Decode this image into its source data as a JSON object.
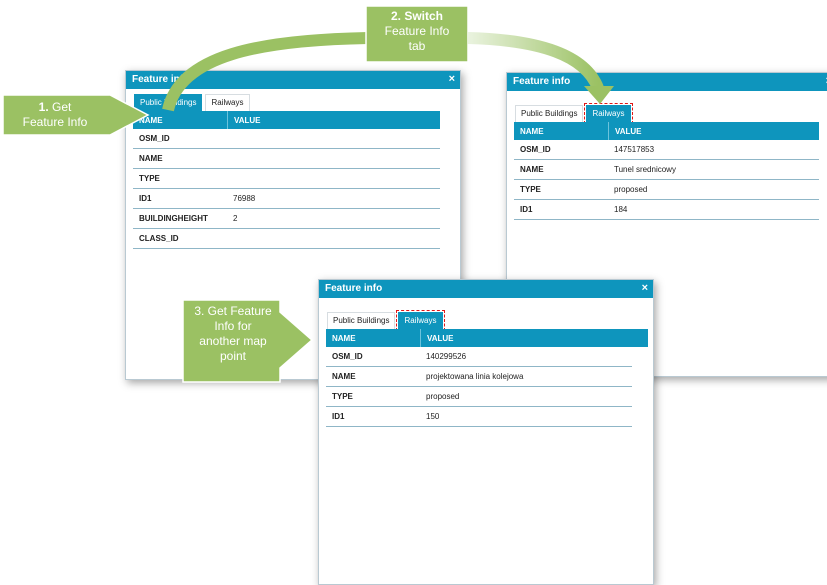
{
  "panel_title": "Feature info",
  "close_symbol": "×",
  "tabs": {
    "public_buildings": "Public Buildings",
    "railways": "Railways"
  },
  "columns": {
    "name": "NAME",
    "value": "VALUE"
  },
  "panel1": {
    "rows": [
      {
        "name": "OSM_ID",
        "value": ""
      },
      {
        "name": "NAME",
        "value": ""
      },
      {
        "name": "TYPE",
        "value": ""
      },
      {
        "name": "ID1",
        "value": "76988"
      },
      {
        "name": "BUILDINGHEIGHT",
        "value": "2"
      },
      {
        "name": "CLASS_ID",
        "value": ""
      }
    ]
  },
  "panel2": {
    "rows": [
      {
        "name": "OSM_ID",
        "value": "147517853"
      },
      {
        "name": "NAME",
        "value": "Tunel srednicowy"
      },
      {
        "name": "TYPE",
        "value": "proposed"
      },
      {
        "name": "ID1",
        "value": "184"
      }
    ]
  },
  "panel3": {
    "rows": [
      {
        "name": "OSM_ID",
        "value": "140299526"
      },
      {
        "name": "NAME",
        "value": "projektowana linia kolejowa"
      },
      {
        "name": "TYPE",
        "value": "proposed"
      },
      {
        "name": "ID1",
        "value": "150"
      }
    ]
  },
  "callouts": {
    "step1": {
      "num": "1.",
      "line1": " Get",
      "line2": "Feature Info"
    },
    "step2": {
      "line1": "2. Switch",
      "line2": "Feature Info",
      "line3": "tab"
    },
    "step3": {
      "line1": "3. Get Feature",
      "line2": "Info for",
      "line3": "another map",
      "line4": "point"
    }
  },
  "colors": {
    "header": "#0e95bd",
    "callout_green": "#9bc163",
    "highlight_red": "#e01818"
  },
  "icons": {
    "close": "close-icon"
  }
}
